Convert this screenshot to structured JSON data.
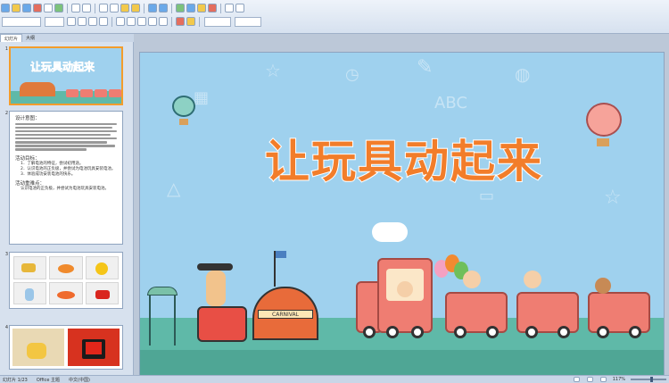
{
  "left_panel": {
    "tabs": [
      "幻灯片",
      "大纲"
    ],
    "slide_numbers": [
      "1",
      "2",
      "3",
      "4"
    ],
    "slide1_title": "让玩具动起来",
    "slide2": {
      "heading1": "设计意图：",
      "heading2": "活动目标：",
      "goal1": "1．了解电池的特征，尝试初用途。",
      "goal2": "2．认识电池的正负极，并尝试为电池玩具安装电池。",
      "goal3": "3．体验成功安装电池的快乐。",
      "heading3": "活动重难点：",
      "key_point": "认识电池的正负极，并尝试为电池玩具安装电池。"
    }
  },
  "slide": {
    "title": "让玩具动起来",
    "sign_text": "CARNIVAL",
    "doodle_text": "ABC"
  },
  "status_bar": {
    "slide_info": "幻灯片 1/23",
    "theme": "Office 主题",
    "language": "中文(中国)",
    "zoom": "117%"
  },
  "colors": {
    "title": "#f27d2a",
    "background": "#9fd1ee",
    "ground": "#5fb9a8",
    "train": "#ef7d72",
    "selected_thumb": "#f39c2b"
  }
}
